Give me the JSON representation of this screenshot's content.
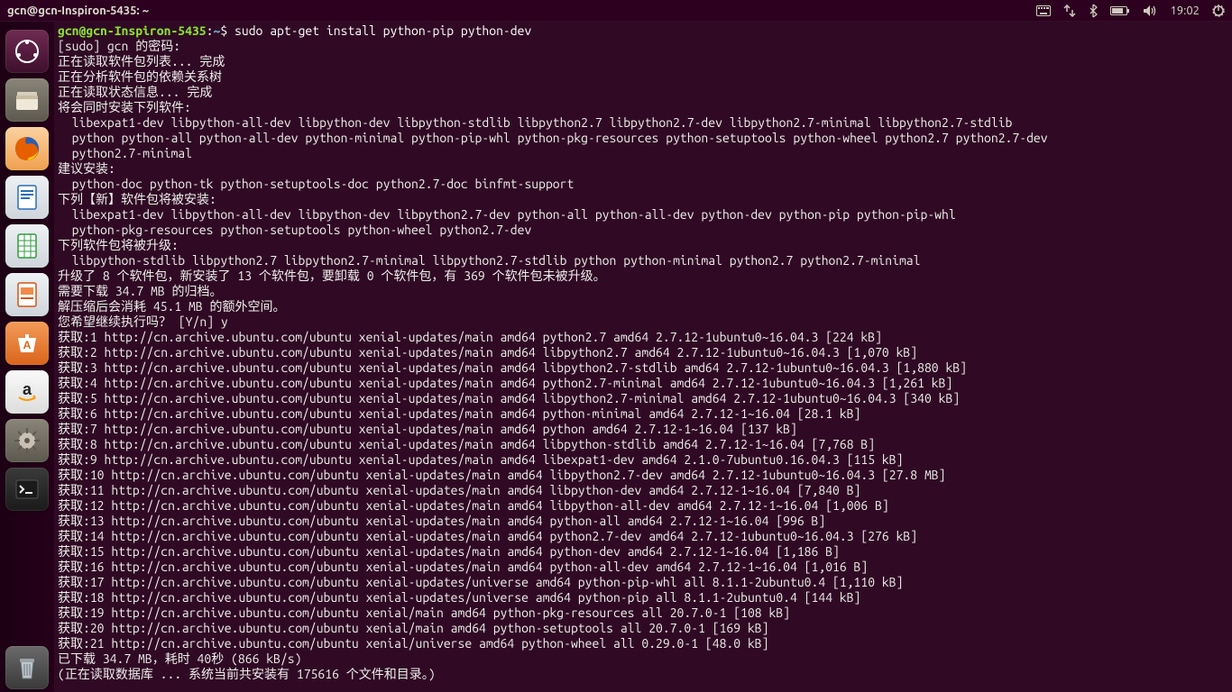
{
  "panel": {
    "title": "gcn@gcn-Inspiron-5435: ~",
    "clock": "19:02"
  },
  "terminal": {
    "prompt_user": "gcn@gcn-Inspiron-5435",
    "prompt_sep": ":",
    "prompt_path": "~",
    "prompt_dollar": "$ ",
    "command": "sudo apt-get install python-pip python-dev",
    "lines": [
      "[sudo] gcn 的密码:",
      "正在读取软件包列表... 完成",
      "正在分析软件包的依赖关系树",
      "正在读取状态信息... 完成",
      "将会同时安装下列软件:",
      "  libexpat1-dev libpython-all-dev libpython-dev libpython-stdlib libpython2.7 libpython2.7-dev libpython2.7-minimal libpython2.7-stdlib",
      "  python python-all python-all-dev python-minimal python-pip-whl python-pkg-resources python-setuptools python-wheel python2.7 python2.7-dev",
      "  python2.7-minimal",
      "建议安装:",
      "  python-doc python-tk python-setuptools-doc python2.7-doc binfmt-support",
      "下列【新】软件包将被安装:",
      "  libexpat1-dev libpython-all-dev libpython-dev libpython2.7-dev python-all python-all-dev python-dev python-pip python-pip-whl",
      "  python-pkg-resources python-setuptools python-wheel python2.7-dev",
      "下列软件包将被升级:",
      "  libpython-stdlib libpython2.7 libpython2.7-minimal libpython2.7-stdlib python python-minimal python2.7 python2.7-minimal",
      "升级了 8 个软件包，新安装了 13 个软件包，要卸载 0 个软件包，有 369 个软件包未被升级。",
      "需要下载 34.7 MB 的归档。",
      "解压缩后会消耗 45.1 MB 的额外空间。",
      "您希望继续执行吗？ [Y/n] y",
      "获取:1 http://cn.archive.ubuntu.com/ubuntu xenial-updates/main amd64 python2.7 amd64 2.7.12-1ubuntu0~16.04.3 [224 kB]",
      "获取:2 http://cn.archive.ubuntu.com/ubuntu xenial-updates/main amd64 libpython2.7 amd64 2.7.12-1ubuntu0~16.04.3 [1,070 kB]",
      "获取:3 http://cn.archive.ubuntu.com/ubuntu xenial-updates/main amd64 libpython2.7-stdlib amd64 2.7.12-1ubuntu0~16.04.3 [1,880 kB]",
      "获取:4 http://cn.archive.ubuntu.com/ubuntu xenial-updates/main amd64 python2.7-minimal amd64 2.7.12-1ubuntu0~16.04.3 [1,261 kB]",
      "获取:5 http://cn.archive.ubuntu.com/ubuntu xenial-updates/main amd64 libpython2.7-minimal amd64 2.7.12-1ubuntu0~16.04.3 [340 kB]",
      "获取:6 http://cn.archive.ubuntu.com/ubuntu xenial-updates/main amd64 python-minimal amd64 2.7.12-1~16.04 [28.1 kB]",
      "获取:7 http://cn.archive.ubuntu.com/ubuntu xenial-updates/main amd64 python amd64 2.7.12-1~16.04 [137 kB]",
      "获取:8 http://cn.archive.ubuntu.com/ubuntu xenial-updates/main amd64 libpython-stdlib amd64 2.7.12-1~16.04 [7,768 B]",
      "获取:9 http://cn.archive.ubuntu.com/ubuntu xenial-updates/main amd64 libexpat1-dev amd64 2.1.0-7ubuntu0.16.04.3 [115 kB]",
      "获取:10 http://cn.archive.ubuntu.com/ubuntu xenial-updates/main amd64 libpython2.7-dev amd64 2.7.12-1ubuntu0~16.04.3 [27.8 MB]",
      "获取:11 http://cn.archive.ubuntu.com/ubuntu xenial-updates/main amd64 libpython-dev amd64 2.7.12-1~16.04 [7,840 B]",
      "获取:12 http://cn.archive.ubuntu.com/ubuntu xenial-updates/main amd64 libpython-all-dev amd64 2.7.12-1~16.04 [1,006 B]",
      "获取:13 http://cn.archive.ubuntu.com/ubuntu xenial-updates/main amd64 python-all amd64 2.7.12-1~16.04 [996 B]",
      "获取:14 http://cn.archive.ubuntu.com/ubuntu xenial-updates/main amd64 python2.7-dev amd64 2.7.12-1ubuntu0~16.04.3 [276 kB]",
      "获取:15 http://cn.archive.ubuntu.com/ubuntu xenial-updates/main amd64 python-dev amd64 2.7.12-1~16.04 [1,186 B]",
      "获取:16 http://cn.archive.ubuntu.com/ubuntu xenial-updates/main amd64 python-all-dev amd64 2.7.12-1~16.04 [1,016 B]",
      "获取:17 http://cn.archive.ubuntu.com/ubuntu xenial-updates/universe amd64 python-pip-whl all 8.1.1-2ubuntu0.4 [1,110 kB]",
      "获取:18 http://cn.archive.ubuntu.com/ubuntu xenial-updates/universe amd64 python-pip all 8.1.1-2ubuntu0.4 [144 kB]",
      "获取:19 http://cn.archive.ubuntu.com/ubuntu xenial/main amd64 python-pkg-resources all 20.7.0-1 [108 kB]",
      "获取:20 http://cn.archive.ubuntu.com/ubuntu xenial/main amd64 python-setuptools all 20.7.0-1 [169 kB]",
      "获取:21 http://cn.archive.ubuntu.com/ubuntu xenial/universe amd64 python-wheel all 0.29.0-1 [48.0 kB]",
      "已下载 34.7 MB，耗时 40秒 (866 kB/s)",
      "(正在读取数据库 ... 系统当前共安装有 175616 个文件和目录。)"
    ]
  }
}
